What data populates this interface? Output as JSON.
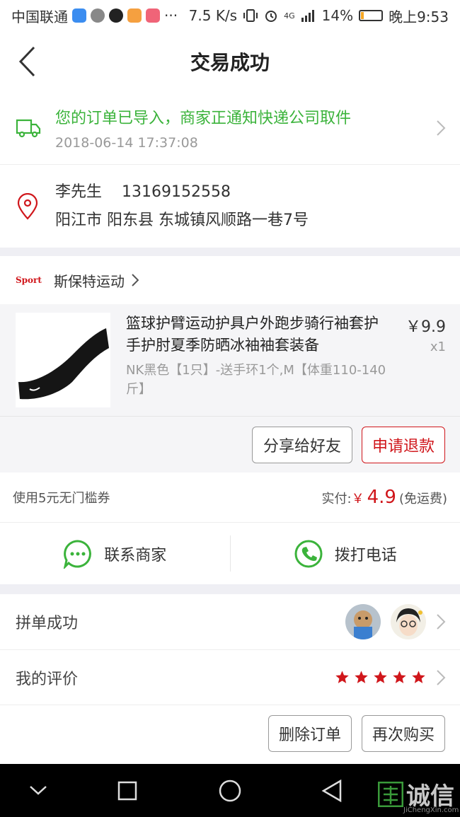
{
  "status_bar": {
    "carrier": "中国联通",
    "ellipsis": "···",
    "speed": "7.5 K/s",
    "network": "4G",
    "battery": "14%",
    "battery_level": 0.14,
    "time": "晚上9:53"
  },
  "nav": {
    "title": "交易成功"
  },
  "shipping": {
    "message": "您的订单已导入，商家正通知快递公司取件",
    "timestamp": "2018-06-14 17:37:08"
  },
  "address": {
    "name": "李先生",
    "phone": "13169152558",
    "detail": "阳江市 阳东县 东城镇风顺路一巷7号"
  },
  "shop": {
    "logo_text": "Sport",
    "name": "斯保特运动"
  },
  "product": {
    "title": "篮球护臂运动护具户外跑步骑行袖套护手护肘夏季防晒冰袖袖套装备",
    "spec": "NK黑色【1只】-送手环1个,M【体重110-140斤】",
    "price": "￥9.9",
    "qty": "x1"
  },
  "item_actions": {
    "share": "分享给好友",
    "refund": "申请退款"
  },
  "payment": {
    "coupon": "使用5元无门槛券",
    "paid_label": "实付:",
    "currency": "￥",
    "amount": "4.9",
    "shipping_note": "(免运费)"
  },
  "contact": {
    "seller": "联系商家",
    "call": "拨打电话"
  },
  "group_buy": {
    "label": "拼单成功"
  },
  "review": {
    "label": "我的评价",
    "stars": 5
  },
  "order_actions": {
    "delete": "删除订单",
    "rebuy": "再次购买"
  },
  "watermark": {
    "text": "诚信",
    "sub": "JiChengXin.com"
  },
  "colors": {
    "accent_red": "#d0161b",
    "success_green": "#3bb33b"
  }
}
